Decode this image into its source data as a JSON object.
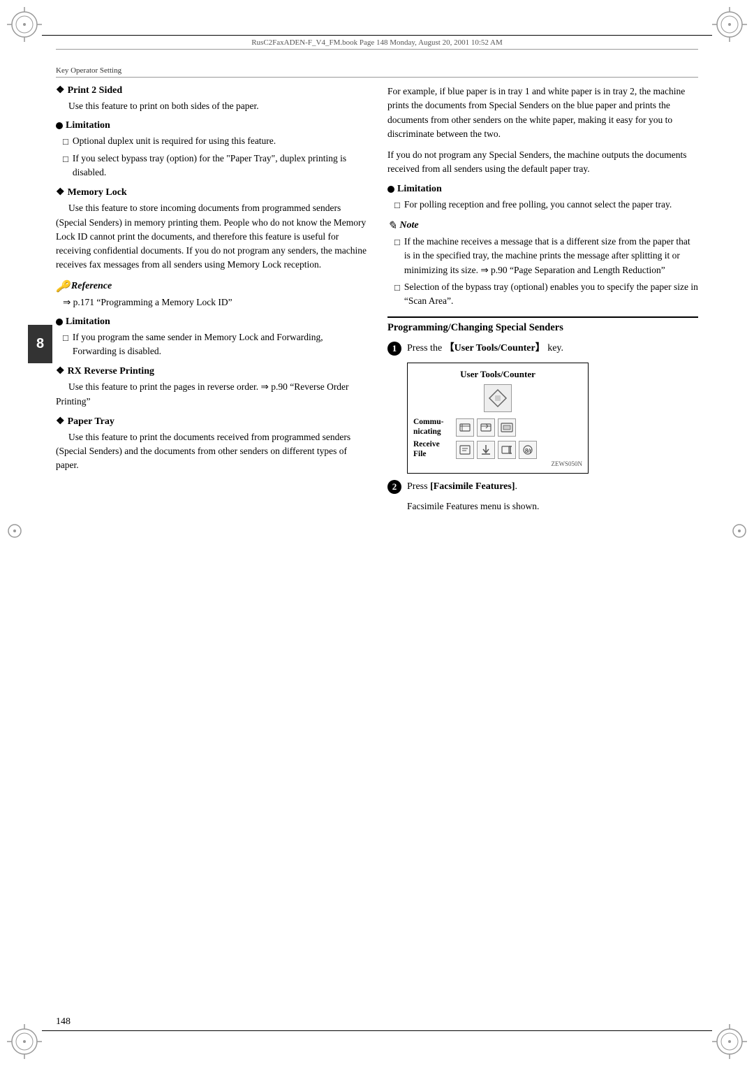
{
  "meta": {
    "page_number": "148",
    "header_text": "RusC2FaxADEN-F_V4_FM.book  Page 148  Monday, August 20, 2001  10:52 AM",
    "key_operator_label": "Key Operator Setting"
  },
  "chapter": {
    "number": "8"
  },
  "left_column": {
    "print_2_sided": {
      "heading": "Print 2 Sided",
      "body": "Use this feature to print on both sides of the paper."
    },
    "limitation_1": {
      "heading": "Limitation",
      "items": [
        "Optional duplex unit is required for using this feature.",
        "If you select bypass tray (option) for the \"Paper Tray\", duplex printing is disabled."
      ]
    },
    "memory_lock": {
      "heading": "Memory Lock",
      "body": "Use this feature to store incoming documents from programmed senders (Special Senders) in memory printing them. People who do not know the Memory Lock ID cannot print the documents, and therefore this feature is useful for receiving confidential documents. If you do not program any senders, the machine receives fax messages from all senders using Memory Lock reception."
    },
    "reference": {
      "heading": "Reference",
      "text": "⇒ p.171 “Programming a Memory Lock ID”"
    },
    "limitation_2": {
      "heading": "Limitation",
      "items": [
        "If you program the same sender in Memory Lock and Forwarding, Forwarding is disabled."
      ]
    },
    "rx_reverse_printing": {
      "heading": "RX Reverse Printing",
      "body": "Use this feature to print the pages in reverse order. ⇒ p.90 “Reverse Order Printing”"
    },
    "paper_tray": {
      "heading": "Paper Tray",
      "body": "Use this feature to print the documents received from programmed senders (Special Senders) and the documents from other senders on different types of paper."
    }
  },
  "right_column": {
    "intro_text": "For example, if blue paper is in tray 1 and white paper is in tray 2, the machine prints the documents from Special Senders on the blue paper and prints the documents from other senders on the white paper, making it easy for you to discriminate between the two.",
    "intro_text2": "If you do not program any Special Senders, the machine outputs the documents received from all senders using the default paper tray.",
    "limitation_3": {
      "heading": "Limitation",
      "items": [
        "For polling reception and free polling, you cannot select the paper tray."
      ]
    },
    "note": {
      "heading": "Note",
      "items": [
        "If the machine receives a message that is a different size from the paper that is in the specified tray, the machine prints the message after splitting it or minimizing its size. ⇒ p.90 “Page Separation and Length Reduction”",
        "Selection of the bypass tray (optional) enables you to specify the paper size in “Scan Area”."
      ]
    },
    "programming_section": {
      "heading": "Programming/Changing Special Senders",
      "step1_text": "Press the 【User Tools/Counter】 key.",
      "panel": {
        "title": "User Tools/Counter",
        "commu_label": "Commu-\nnicating",
        "receive_label": "Receive\nFile"
      },
      "panel_caption": "ZEWS050N",
      "step2_text": "Press [Facsimile Features].",
      "step2_note": "Facsimile Features menu is shown."
    }
  }
}
